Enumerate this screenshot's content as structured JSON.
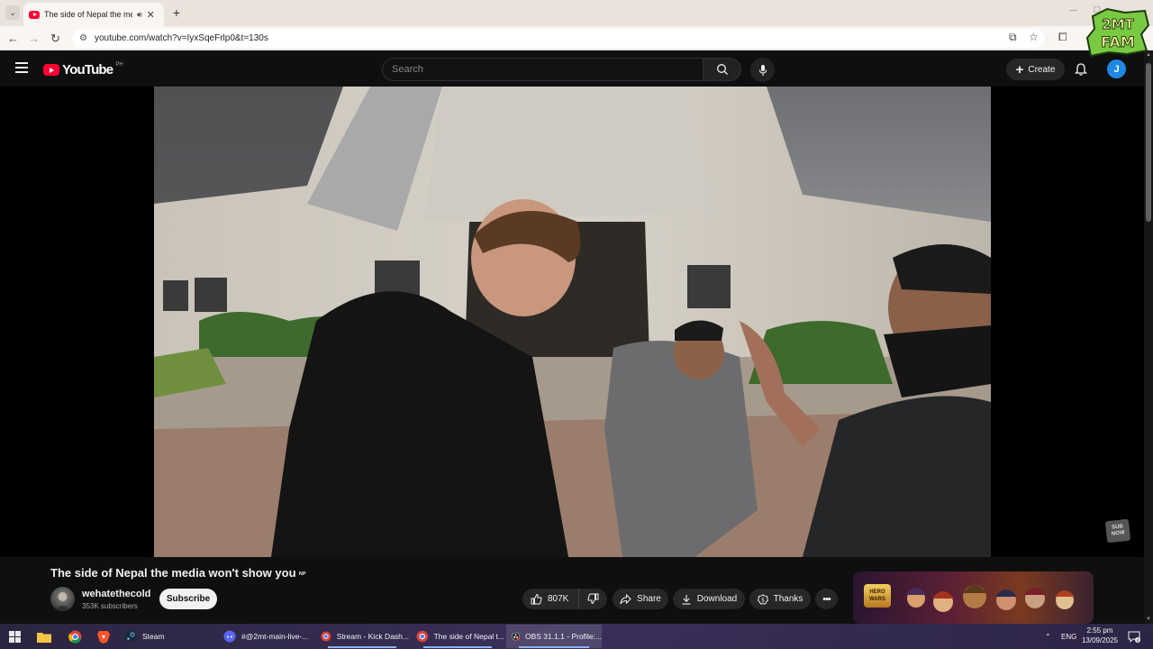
{
  "browser": {
    "tab_title": "The side of Nepal the media",
    "address_url": "youtube.com/watch?v=IyxSqeFrlp0&t=130s"
  },
  "youtube": {
    "logo_text": "YouTube",
    "country_code": "PH",
    "search_placeholder": "Search",
    "create_label": "Create",
    "avatar_letter": "J"
  },
  "video": {
    "title": "The side of Nepal the media won't show you",
    "title_flag": "ᴺᴾ",
    "watermark_text": "SUB NOW",
    "watermark_line1": "SUB",
    "watermark_line2": "NOW"
  },
  "channel": {
    "name": "wehatethecold",
    "subscribers": "353K subscribers",
    "subscribe_label": "Subscribe"
  },
  "actions": {
    "likes": "807K",
    "share": "Share",
    "download": "Download",
    "thanks": "Thanks"
  },
  "ad": {
    "logo_line1": "HERO",
    "logo_line2": "WARS"
  },
  "taskbar": {
    "items": [
      {
        "label": "Steam"
      },
      {
        "label": "#@2mt-main-live-..."
      },
      {
        "label": "Stream - Kick Dash..."
      },
      {
        "label": "The side of Nepal t..."
      },
      {
        "label": "OBS 31.1.1 - Profile:..."
      }
    ],
    "lang": "ENG",
    "time": "2:55 pm",
    "date": "13/09/2025",
    "notif_count": "4"
  },
  "overlay": {
    "fam_logo_text": "2MT FAM"
  },
  "colors": {
    "yt_red": "#ff0033",
    "yt_bg": "#0f0f0f",
    "avatar_blue": "#1e88e5",
    "pill_bg": "#272727"
  }
}
